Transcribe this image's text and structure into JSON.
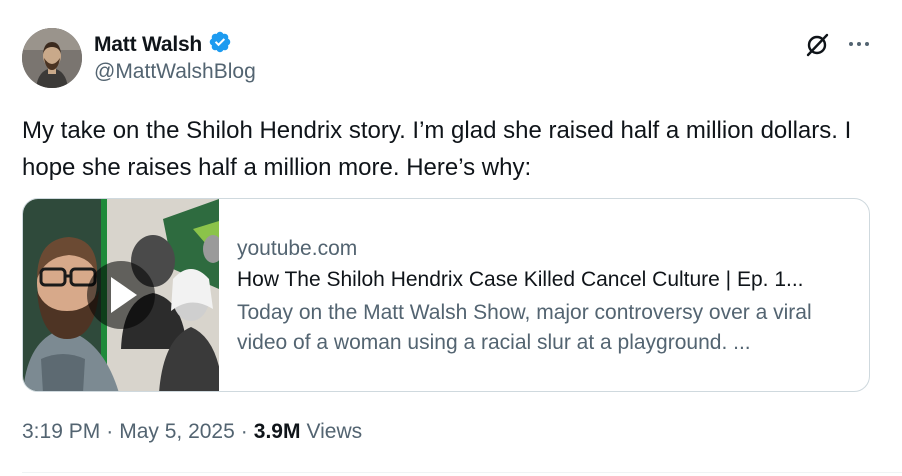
{
  "author": {
    "name": "Matt Walsh",
    "handle": "@MattWalshBlog",
    "verified": true
  },
  "tweet": {
    "text": "My take on the Shiloh Hendrix story. I’m glad she raised half a million dollars. I hope she raises half a million more. Here’s why:"
  },
  "card": {
    "domain": "youtube.com",
    "title": "How The Shiloh Hendrix Case Killed Cancel Culture | Ep. 1...",
    "description": "Today on the Matt Walsh Show, major controversy over a viral video of a woman using a racial slur at a playground. ..."
  },
  "meta": {
    "time": "3:19 PM",
    "date": "May 5, 2025",
    "views_count": "3.9M",
    "views_label": "Views"
  },
  "colors": {
    "verified_badge": "#1d9bf0",
    "secondary_text": "#536471",
    "primary_text": "#0f1419",
    "card_border": "#cfd9de"
  }
}
